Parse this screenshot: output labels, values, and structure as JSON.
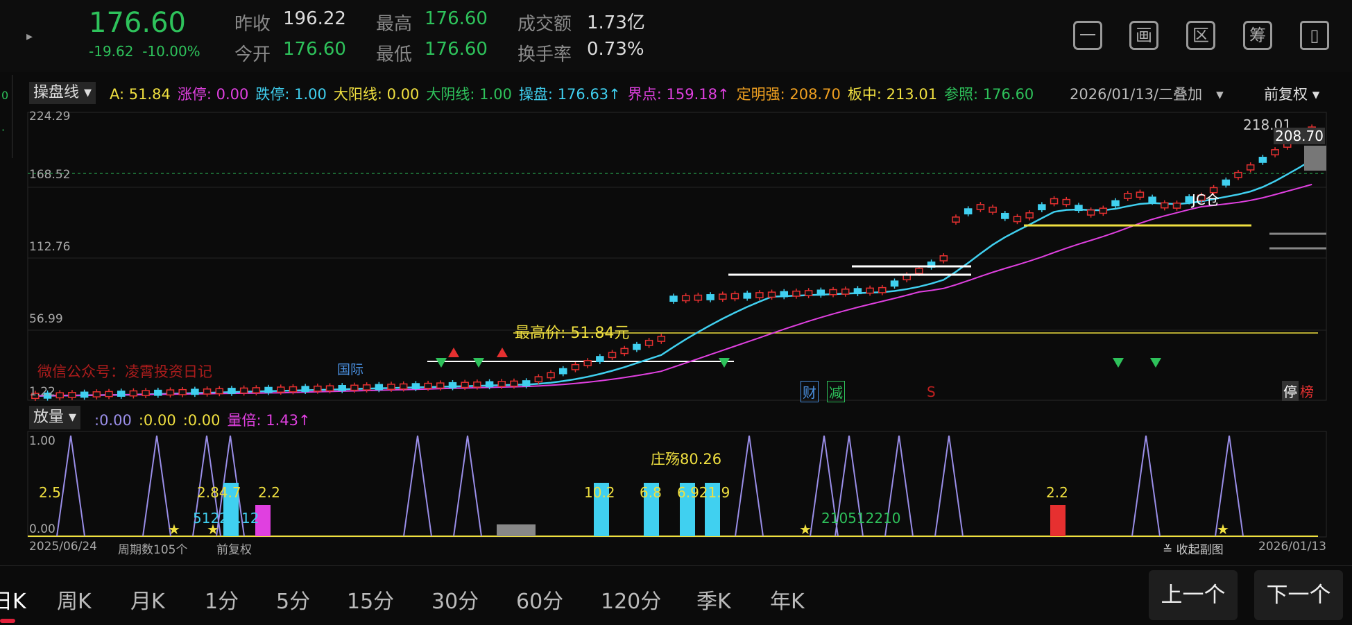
{
  "header": {
    "price": "176.60",
    "change": "-19.62",
    "change_pct": "-10.00%",
    "prev_close_label": "昨收",
    "prev_close": "196.22",
    "open_label": "今开",
    "open": "176.60",
    "high_label": "最高",
    "high": "176.60",
    "low_label": "最低",
    "low": "176.60",
    "turnover_label": "成交额",
    "turnover": "1.73亿",
    "turnover_rate_label": "换手率",
    "turnover_rate": "0.73%",
    "icons": [
      "minus-box-icon",
      "chart-box-icon",
      "interval-box-icon",
      "filter-box-icon",
      "device-switch-icon"
    ],
    "icon_glyphs": [
      "一",
      "画",
      "区",
      "筹",
      "▯"
    ]
  },
  "indicator": {
    "main_dropdown": "操盘线",
    "items": [
      {
        "text": "A: 51.84",
        "color": "#f0e040"
      },
      {
        "text": "涨停: 0.00",
        "color": "#e040e0"
      },
      {
        "text": "跌停: 1.00",
        "color": "#40d0f0"
      },
      {
        "text": "大阳线: 0.00",
        "color": "#f0e040"
      },
      {
        "text": "大阴线: 1.00",
        "color": "#2ec25b"
      },
      {
        "text": "操盘: 176.63↑",
        "color": "#40d0f0"
      },
      {
        "text": "界点: 159.18↑",
        "color": "#e040e0"
      },
      {
        "text": "定明强: 208.70",
        "color": "#f0a020"
      },
      {
        "text": "板中: 213.01",
        "color": "#f0e040"
      },
      {
        "text": "参照: 176.60",
        "color": "#2ec25b"
      }
    ],
    "date_mode": "2026/01/13/二叠加",
    "adjust": "前复权"
  },
  "main_axis": {
    "labels": [
      "224.29",
      "168.52",
      "112.76",
      "56.99",
      "1.22"
    ]
  },
  "annotations": {
    "high_price": "最高价: 51.84元",
    "label_218": "218.01",
    "label_208": "208.70",
    "tag_cai": "财",
    "tag_jian": "减",
    "tag_s": "S",
    "tag_ting": "停",
    "tag_bang": "榜",
    "tag_jc": "JC仓",
    "watermark": "微信公众号：凌霄投资日记",
    "blue_note": "国际"
  },
  "sub_indicator": {
    "dropdown": "放量",
    "items": [
      {
        "text": ":0.00",
        "color": "#9a8ee8"
      },
      {
        "text": ":0.00",
        "color": "#f0e040"
      },
      {
        "text": ":0.00",
        "color": "#f0e040"
      },
      {
        "text": "量倍: 1.43↑",
        "color": "#e040e0"
      }
    ],
    "axis_labels": [
      "1.00",
      "0.00"
    ],
    "bar_labels": [
      "2.5",
      "2.84.7",
      "2.2",
      "10.2",
      "6.8",
      "6.921.9",
      "2.2"
    ],
    "bottom_labels": [
      "51225.12",
      "210512210"
    ],
    "zhuang": "庄殇80.26"
  },
  "bottom_info": {
    "start_date": "2025/06/24",
    "period_count": "周期数105个",
    "adjust": "前复权",
    "collapse": "收起副图",
    "end_date": "2026/01/13"
  },
  "periods": [
    "日K",
    "周K",
    "月K",
    "1分",
    "5分",
    "15分",
    "30分",
    "60分",
    "120分",
    "季K",
    "年K"
  ],
  "nav": {
    "prev": "上一个",
    "next": "下一个"
  },
  "colors": {
    "up": "#e63030",
    "down": "#2ec25b",
    "cyan": "#40d0f0",
    "magenta": "#e040e0",
    "yellow": "#f0e040"
  },
  "chart_data": {
    "type": "candlestick",
    "y_axis": {
      "min": 1.22,
      "max": 224.29,
      "ticks": [
        224.29,
        168.52,
        112.76,
        56.99,
        1.22
      ]
    },
    "x_range": [
      "2025/06/24",
      "2026/01/13"
    ],
    "bars": 105,
    "last_price": 176.6,
    "ma_lines": [
      "cyan",
      "magenta"
    ]
  }
}
